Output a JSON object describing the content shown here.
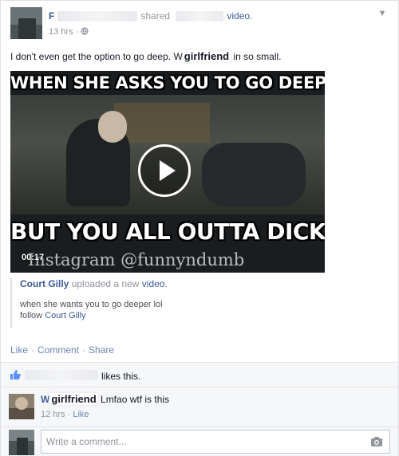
{
  "post": {
    "author_name": "F",
    "shared_text": "shared",
    "video_link": "video.",
    "timestamp": "13 hrs",
    "privacy_icon": "globe-icon",
    "status_prefix": "I don't even get the option to go deep. W",
    "tag_label": "girlfriend",
    "status_suffix": "in so small."
  },
  "video": {
    "top_caption": "WHEN SHE ASKS YOU TO GO DEEPER",
    "bottom_caption": "BUT YOU ALL OUTTA DICK",
    "watermark": "Instagram @funnyndumb",
    "duration": "00:17",
    "play_icon": "play-icon"
  },
  "attribution": {
    "author": "Court Gilly",
    "uploaded_text": "uploaded a new",
    "video_link": "video.",
    "caption_line1": "when she wants you to go deeper lol",
    "caption_follow": "follow",
    "caption_follow_link": "Court Gilly"
  },
  "actions": {
    "like": "Like",
    "comment": "Comment",
    "share": "Share",
    "separator": "·"
  },
  "likes": {
    "text": "likes this.",
    "icon": "thumbs-up-icon"
  },
  "comment": {
    "author_prefix": "W",
    "author_tag": "girlfriend",
    "text": "Lmfao wtf is this",
    "time": "12 hrs",
    "like_label": "Like"
  },
  "compose": {
    "placeholder": "Write a comment...",
    "camera_icon": "camera-icon"
  },
  "colors": {
    "link": "#3b5998",
    "muted": "#90949c",
    "action": "#6d84b4",
    "panel_bg": "#f6f7f9"
  }
}
